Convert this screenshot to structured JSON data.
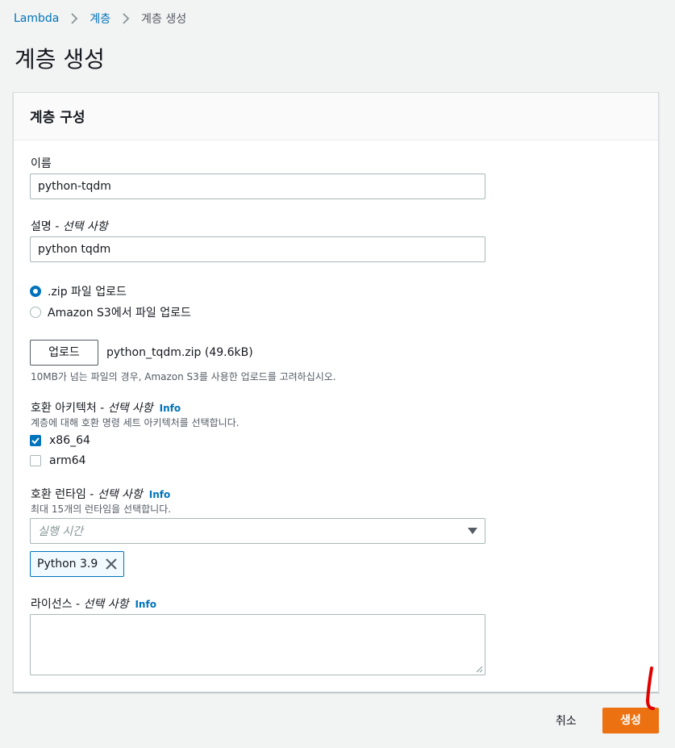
{
  "breadcrumb": {
    "items": [
      "Lambda",
      "계층",
      "계층 생성"
    ]
  },
  "page": {
    "title": "계층 생성"
  },
  "panel": {
    "title": "계층 구성"
  },
  "name_field": {
    "label": "이름",
    "value": "python-tqdm"
  },
  "description_field": {
    "label": "설명 - ",
    "optional": "선택 사항",
    "value": "python tqdm"
  },
  "upload_options": {
    "zip_label": ".zip 파일 업로드",
    "s3_label": "Amazon S3에서 파일 업로드",
    "selected": "zip"
  },
  "upload": {
    "button_label": "업로드",
    "file_name": "python_tqdm.zip (49.6kB)",
    "hint": "10MB가 넘는 파일의 경우, Amazon S3를 사용한 업로드를 고려하십시오."
  },
  "architectures": {
    "label": "호환 아키텍처 - ",
    "optional": "선택 사항",
    "info": "Info",
    "hint": "계층에 대해 호환 명령 세트 아키텍처를 선택합니다.",
    "options": [
      {
        "label": "x86_64",
        "checked": true
      },
      {
        "label": "arm64",
        "checked": false
      }
    ]
  },
  "runtimes": {
    "label": "호환 런타임 - ",
    "optional": "선택 사항",
    "info": "Info",
    "hint": "최대 15개의 런타임을 선택합니다.",
    "placeholder": "실행 시간",
    "selected_token": "Python 3.9"
  },
  "license": {
    "label": "라이선스 - ",
    "optional": "선택 사항",
    "info": "Info"
  },
  "footer": {
    "cancel_label": "취소",
    "create_label": "생성"
  },
  "colors": {
    "link": "#0073bb",
    "primary": "#ec7211",
    "annotation": "#e00000"
  }
}
